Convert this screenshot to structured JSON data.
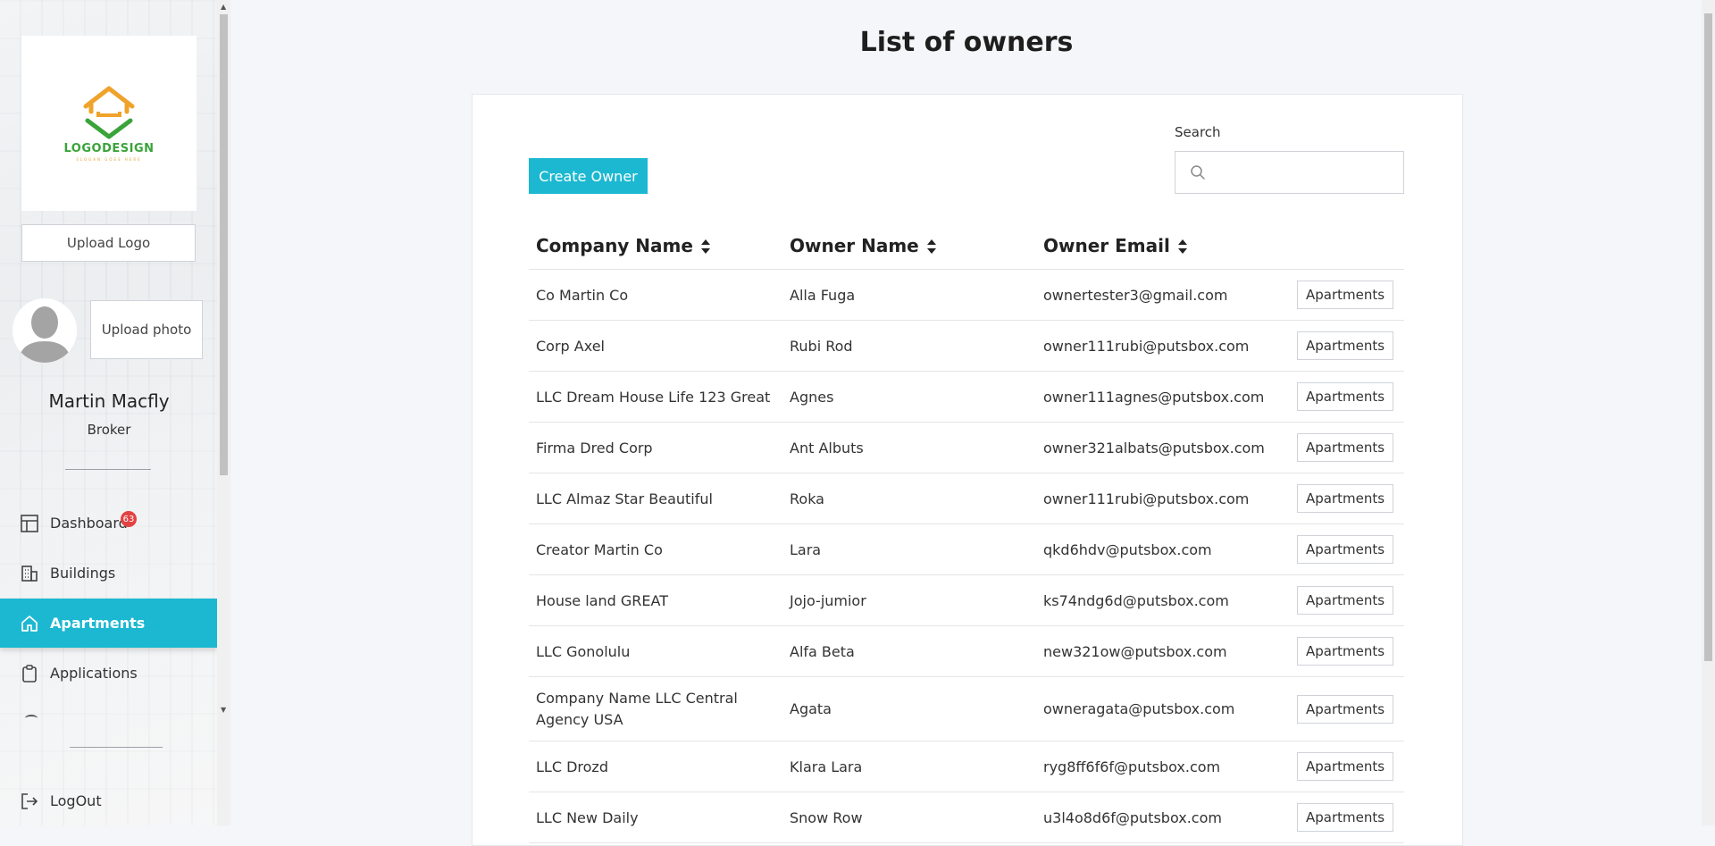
{
  "sidebar": {
    "logo": {
      "text": "LOGODESIGN",
      "slogan": "SLOGAN GOES HERE",
      "colors": {
        "roof": "#f0a32a",
        "check": "#3aa33a"
      }
    },
    "upload_logo_label": "Upload Logo",
    "upload_photo_label": "Upload photo",
    "user": {
      "name": "Martin Macfly",
      "role": "Broker"
    },
    "nav": [
      {
        "label": "Dashboard",
        "icon": "dashboard-icon",
        "badge": "63",
        "active": false
      },
      {
        "label": "Buildings",
        "icon": "buildings-icon",
        "active": false
      },
      {
        "label": "Apartments",
        "icon": "home-icon",
        "active": true
      },
      {
        "label": "Applications",
        "icon": "clipboard-icon",
        "active": false
      }
    ],
    "logout_label": "LogOut"
  },
  "main": {
    "title": "List of owners",
    "create_button": "Create Owner",
    "search": {
      "label": "Search",
      "placeholder": "",
      "value": ""
    },
    "columns": [
      "Company Name",
      "Owner Name",
      "Owner Email"
    ],
    "row_action": "Apartments",
    "rows": [
      {
        "company": "Co Martin Co",
        "owner": "Alla Fuga",
        "email": "ownertester3@gmail.com"
      },
      {
        "company": "Corp Axel",
        "owner": "Rubi Rod",
        "email": "owner111rubi@putsbox.com"
      },
      {
        "company": "LLC Dream House Life 123 Great",
        "owner": "Agnes",
        "email": "owner111agnes@putsbox.com"
      },
      {
        "company": "Firma Dred Corp",
        "owner": "Ant Albuts",
        "email": "owner321albats@putsbox.com"
      },
      {
        "company": "LLC Almaz Star Beautiful",
        "owner": "Roka",
        "email": "owner111rubi@putsbox.com"
      },
      {
        "company": "Creator Martin Co",
        "owner": "Lara",
        "email": "qkd6hdv@putsbox.com"
      },
      {
        "company": "House land GREAT",
        "owner": "Jojo-jumior",
        "email": "ks74ndg6d@putsbox.com"
      },
      {
        "company": "LLC Gonolulu",
        "owner": "Alfa Beta",
        "email": "new321ow@putsbox.com"
      },
      {
        "company": "Company Name LLC Central Agency USA",
        "owner": "Agata",
        "email": "owneragata@putsbox.com"
      },
      {
        "company": "LLC Drozd",
        "owner": "Klara Lara",
        "email": "ryg8ff6f6f@putsbox.com"
      },
      {
        "company": "LLC New Daily",
        "owner": "Snow Row",
        "email": "u3l4o8d6f@putsbox.com"
      }
    ]
  },
  "colors": {
    "accent": "#1cb8d1",
    "badge": "#e24242"
  }
}
